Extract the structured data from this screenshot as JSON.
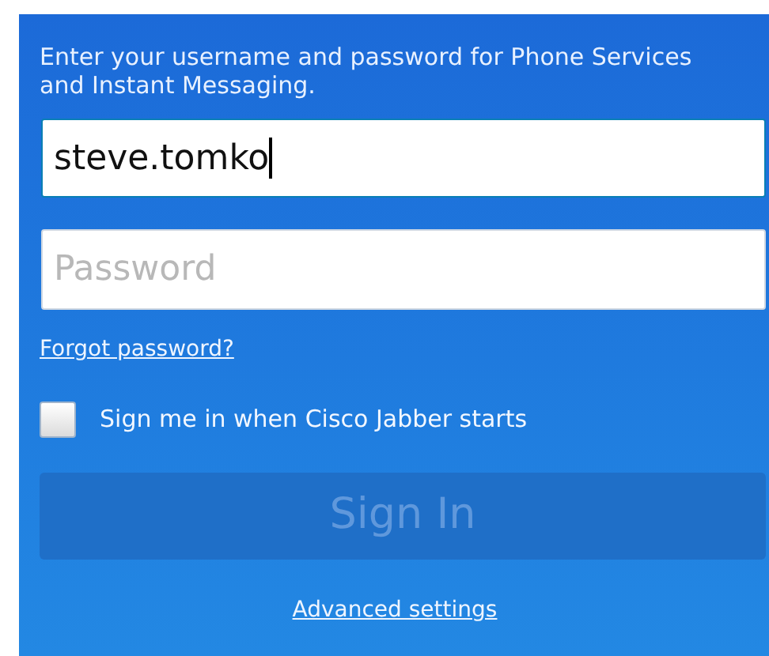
{
  "instructions": "Enter your username and password for Phone Services and Instant Messaging.",
  "username": {
    "value": "steve.tomko",
    "focused": true
  },
  "password": {
    "placeholder": "Password"
  },
  "forgot_link": "Forgot password?",
  "auto_sign_in": {
    "label": "Sign me in when Cisco Jabber starts",
    "checked": false
  },
  "sign_in_button": {
    "label": "Sign In",
    "disabled": true
  },
  "advanced_link": "Advanced settings"
}
